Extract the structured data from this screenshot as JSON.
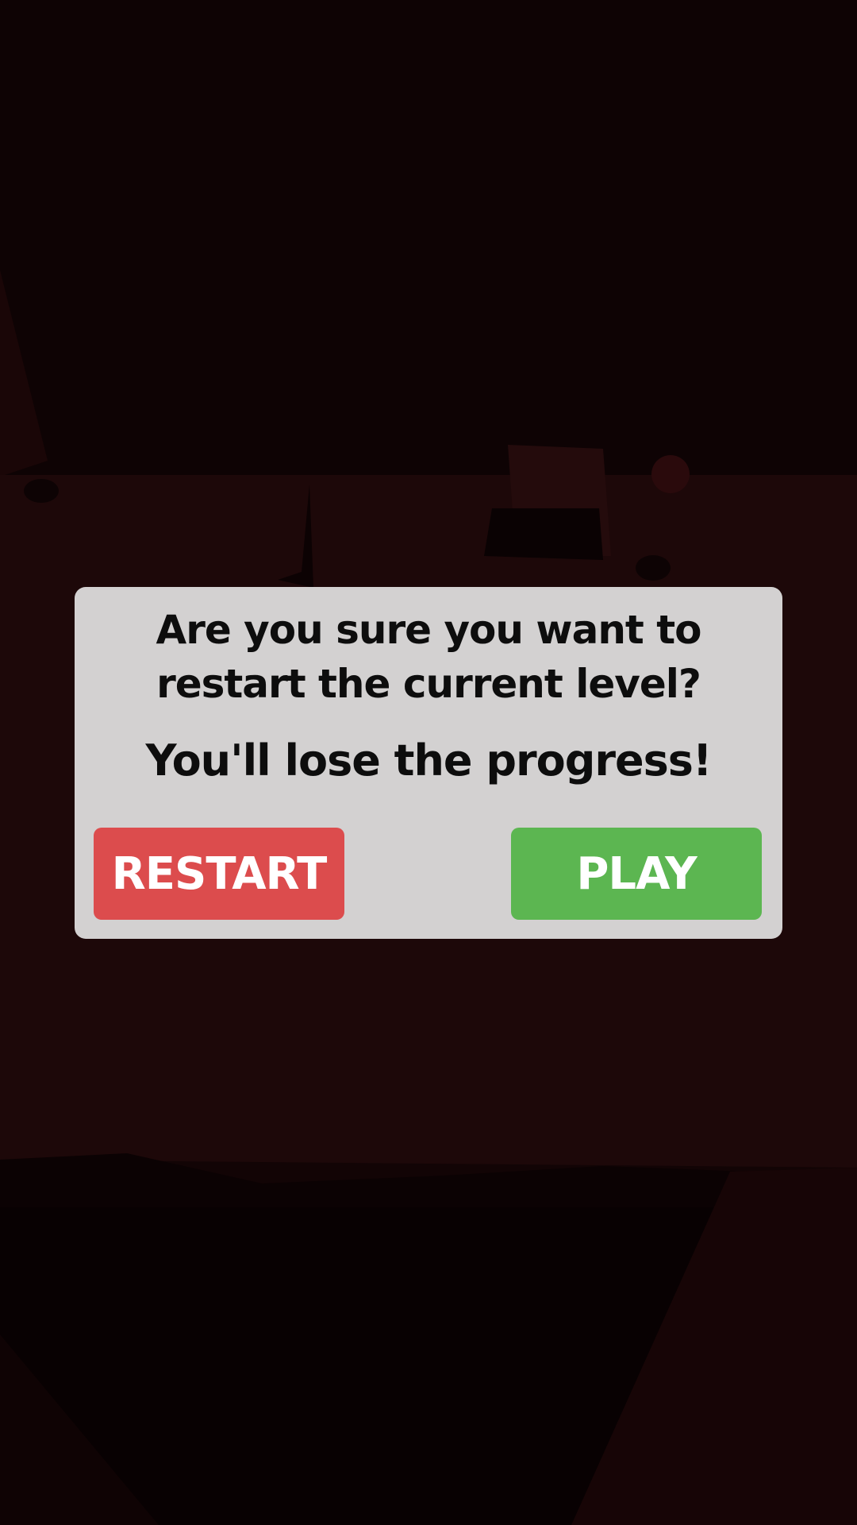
{
  "dialog": {
    "question": "Are you sure you want to restart the current level?",
    "warning": "You'll lose the progress!",
    "restart_label": "RESTART",
    "play_label": "PLAY"
  },
  "colors": {
    "restart_button": "#dc4c4d",
    "play_button": "#5cb651",
    "dialog_background": "#e8e8e8",
    "text": "#0d0d0d",
    "scene_dim": "#140506"
  }
}
